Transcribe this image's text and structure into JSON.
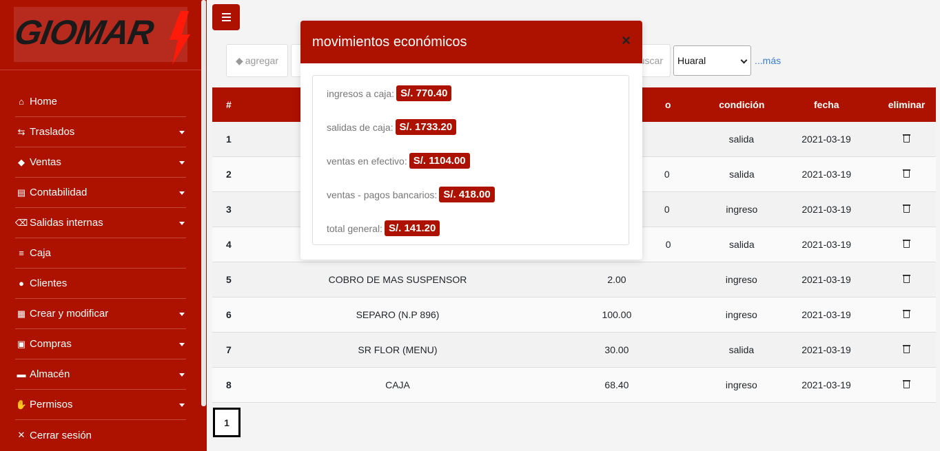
{
  "brand": {
    "logo_text": "GIOMAR"
  },
  "sidebar": {
    "items": [
      {
        "label": "Home",
        "icon": "home-icon",
        "glyph": "⌂",
        "dropdown": false
      },
      {
        "label": "Traslados",
        "icon": "people-carry-icon",
        "glyph": "⇆",
        "dropdown": true
      },
      {
        "label": "Ventas",
        "icon": "piggy-bank-icon",
        "glyph": "◆",
        "dropdown": true
      },
      {
        "label": "Contabilidad",
        "icon": "chart-bar-icon",
        "glyph": "▤",
        "dropdown": true
      },
      {
        "label": "Salidas internas",
        "icon": "backspace-icon",
        "glyph": "⌫",
        "dropdown": true
      },
      {
        "label": "Caja",
        "icon": "coins-icon",
        "glyph": "≡",
        "dropdown": false
      },
      {
        "label": "Clientes",
        "icon": "users-icon",
        "glyph": "●",
        "dropdown": false
      },
      {
        "label": "Crear y modificar",
        "icon": "boxes-icon",
        "glyph": "▦",
        "dropdown": true
      },
      {
        "label": "Compras",
        "icon": "shopping-bag-icon",
        "glyph": "▣",
        "dropdown": true
      },
      {
        "label": "Almacén",
        "icon": "archive-icon",
        "glyph": "▬",
        "dropdown": true
      },
      {
        "label": "Permisos",
        "icon": "hand-icon",
        "glyph": "✋",
        "dropdown": true
      },
      {
        "label": "Cerrar sesión",
        "icon": "times-icon",
        "glyph": "✕",
        "dropdown": false
      }
    ]
  },
  "toolbar": {
    "agregar_label": "agregar",
    "buscar_label": "uscar",
    "sede_selected": "Huaral",
    "mas_label": "...más"
  },
  "table": {
    "headers": {
      "num": "#",
      "condicion": "condición",
      "fecha": "fecha",
      "eliminar": "eliminar",
      "monto_partial": "o"
    },
    "rows": [
      {
        "num": "1",
        "desc": "",
        "monto": "",
        "cond": "salida",
        "fecha": "2021-03-19"
      },
      {
        "num": "2",
        "desc": "",
        "monto": "0",
        "cond": "salida",
        "fecha": "2021-03-19"
      },
      {
        "num": "3",
        "desc": "",
        "monto": "0",
        "cond": "ingreso",
        "fecha": "2021-03-19"
      },
      {
        "num": "4",
        "desc": "",
        "monto": "0",
        "cond": "salida",
        "fecha": "2021-03-19"
      },
      {
        "num": "5",
        "desc": "COBRO DE MAS SUSPENSOR",
        "monto": "2.00",
        "cond": "ingreso",
        "fecha": "2021-03-19"
      },
      {
        "num": "6",
        "desc": "SEPARO (N.P 896)",
        "monto": "100.00",
        "cond": "ingreso",
        "fecha": "2021-03-19"
      },
      {
        "num": "7",
        "desc": "SR FLOR (MENU)",
        "monto": "30.00",
        "cond": "salida",
        "fecha": "2021-03-19"
      },
      {
        "num": "8",
        "desc": "CAJA",
        "monto": "68.40",
        "cond": "ingreso",
        "fecha": "2021-03-19"
      }
    ]
  },
  "pagination": {
    "current": "1"
  },
  "modal": {
    "title": "movimientos económicos",
    "close": "×",
    "stats": [
      {
        "label": "ingresos a caja:",
        "value": "S/. 770.40"
      },
      {
        "label": "salidas de caja:",
        "value": "S/. 1733.20"
      },
      {
        "label": "ventas en efectivo:",
        "value": "S/. 1104.00"
      },
      {
        "label": "ventas - pagos bancarios:",
        "value": "S/. 418.00"
      },
      {
        "label": "total general:",
        "value": "S/. 141.20"
      }
    ]
  },
  "colors": {
    "brand": "#ad1100",
    "link": "#3a7bd5"
  }
}
